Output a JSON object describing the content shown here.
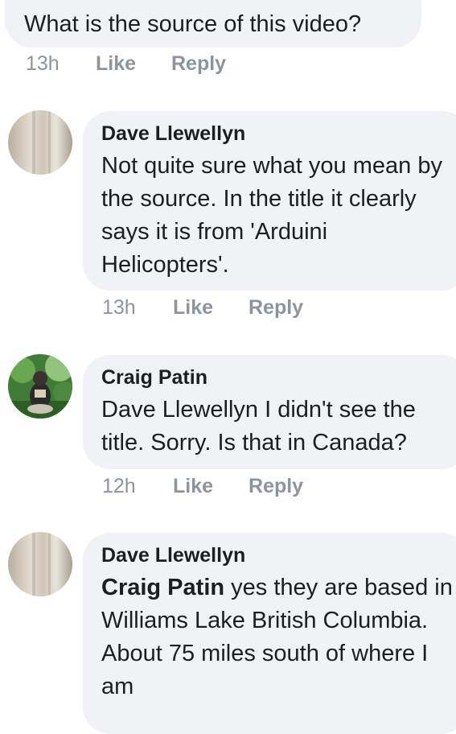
{
  "comments": [
    {
      "author": "",
      "text": "What is the source of this video?",
      "time": "13h",
      "like": "Like",
      "reply": "Reply"
    },
    {
      "author": "Dave Llewellyn",
      "text": "Not quite sure what you mean by the source. In the title it clearly says it is from 'Arduini Helicopters'.",
      "time": "13h",
      "like": "Like",
      "reply": "Reply"
    },
    {
      "author": "Craig Patin",
      "text": "Dave Llewellyn I didn't see the title. Sorry. Is that in Canada?",
      "time": "12h",
      "like": "Like",
      "reply": "Reply"
    },
    {
      "author": "Dave Llewellyn",
      "mention": "Craig Patin",
      "text": " yes they are based in Williams Lake British Columbia. About 75 miles south of where I am",
      "time": "",
      "like": "",
      "reply": ""
    }
  ]
}
